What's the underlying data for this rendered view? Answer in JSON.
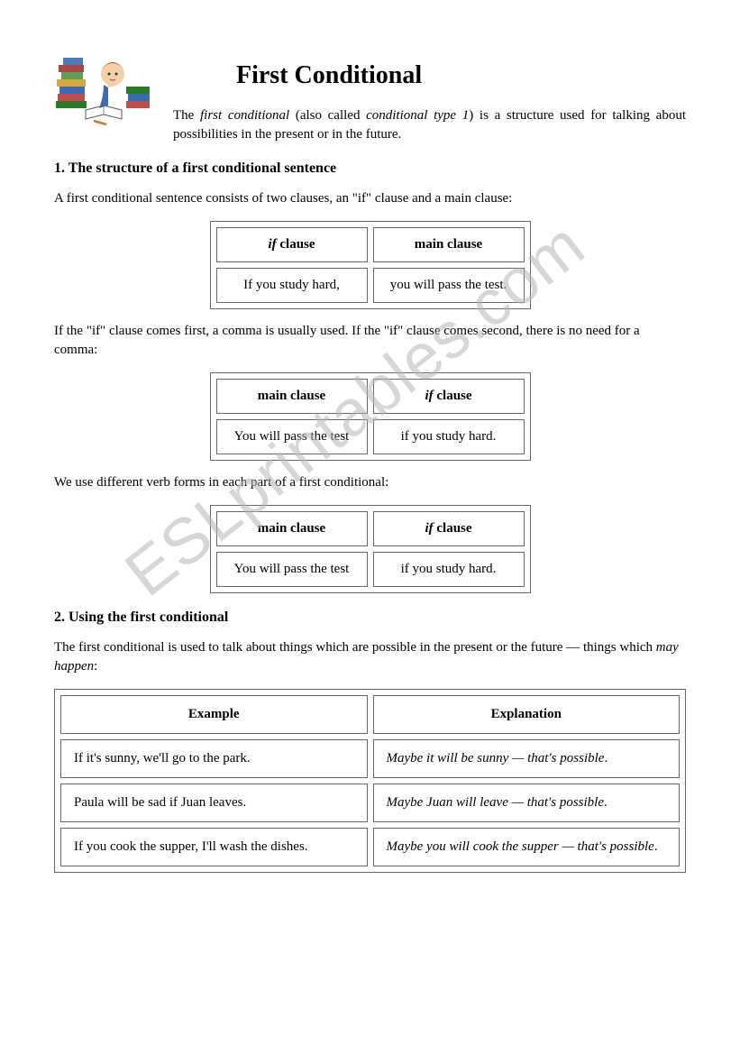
{
  "watermark": "ESLprintables.com",
  "title": "First Conditional",
  "intro_parts": {
    "a": "The ",
    "b": "first conditional",
    "c": " (also called ",
    "d": "conditional type 1",
    "e": ") is a structure used for talking about possibilities in the present or in the future."
  },
  "section1": {
    "heading": "1. The structure of a first conditional sentence",
    "p1": "A first conditional sentence consists of two clauses, an \"if\" clause and a main clause:",
    "table1": {
      "h1_pre": "if",
      "h1_post": " clause",
      "h2": "main clause",
      "c1": "If you study hard,",
      "c2": "you will pass the test."
    },
    "p2": "If the \"if\" clause comes first, a comma is usually used. If the \"if\" clause comes second, there is no need for a comma:",
    "table2": {
      "h1": "main clause",
      "h2_pre": "if",
      "h2_post": " clause",
      "c1": "You will pass the test",
      "c2": "if you study hard."
    },
    "p3": "We use different verb forms in each part of a first conditional:",
    "table3": {
      "h1": "main clause",
      "h2_pre": "if",
      "h2_post": " clause",
      "c1": "You will pass the test",
      "c2": "if you study hard."
    }
  },
  "section2": {
    "heading": "2. Using the first conditional",
    "p1_a": "The first conditional is used to talk about things which are possible in the present or the future — things which ",
    "p1_b": "may happen",
    "p1_c": ":",
    "headers": {
      "ex": "Example",
      "exp": "Explanation"
    },
    "rows": [
      {
        "ex": "If it's sunny, we'll go to the park.",
        "exp": "Maybe it will be sunny — that's possible"
      },
      {
        "ex": "Paula will be sad if Juan leaves.",
        "exp": "Maybe Juan will leave — that's possible"
      },
      {
        "ex": "If you cook the supper, I'll wash the dishes.",
        "exp": "Maybe you will cook the supper — that's possible"
      }
    ]
  }
}
